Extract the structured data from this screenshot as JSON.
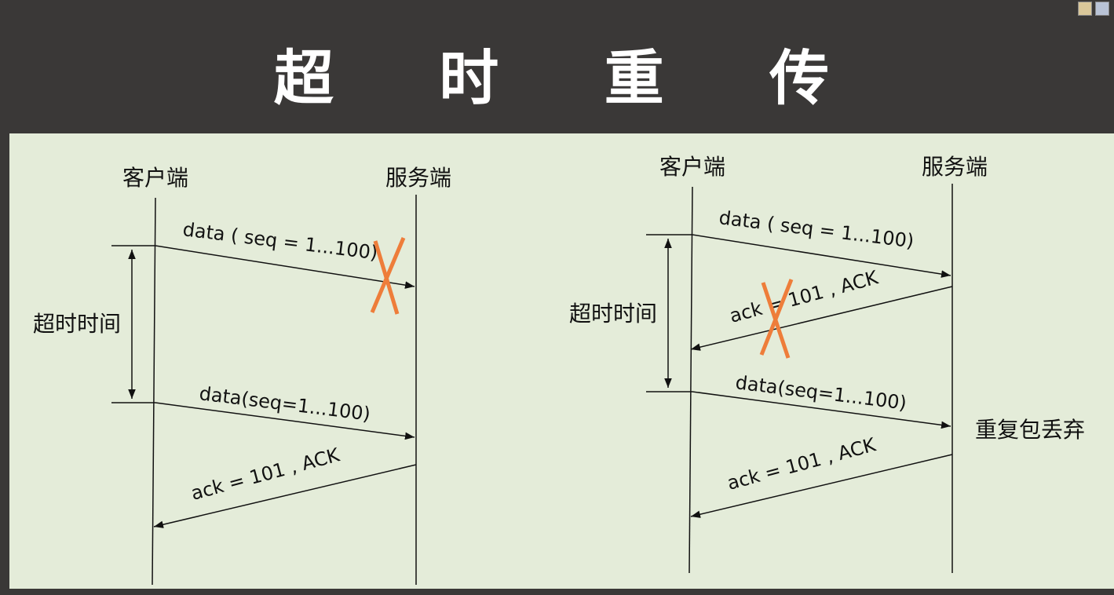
{
  "title": "超 时 重 传",
  "left": {
    "client_label": "客户端",
    "server_label": "服务端",
    "timeout_label": "超时时间",
    "msg1": "data ( seq = 1...100)",
    "msg2": "data(seq=1...100)",
    "msg3": "ack = 101 , ACK"
  },
  "right": {
    "client_label": "客户端",
    "server_label": "服务端",
    "timeout_label": "超时时间",
    "msg1": "data ( seq = 1...100)",
    "msg2": "ack = 101 , ACK",
    "msg3": "data(seq=1...100)",
    "msg4": "ack = 101 , ACK",
    "duplicate_note": "重复包丢弃"
  },
  "colors": {
    "background": "#3a3837",
    "slide": "#e4ecd9",
    "lost_mark": "#ee7d3a",
    "line": "#111111"
  },
  "icons": [
    "tray-app-icon",
    "tray-grid-icon"
  ]
}
